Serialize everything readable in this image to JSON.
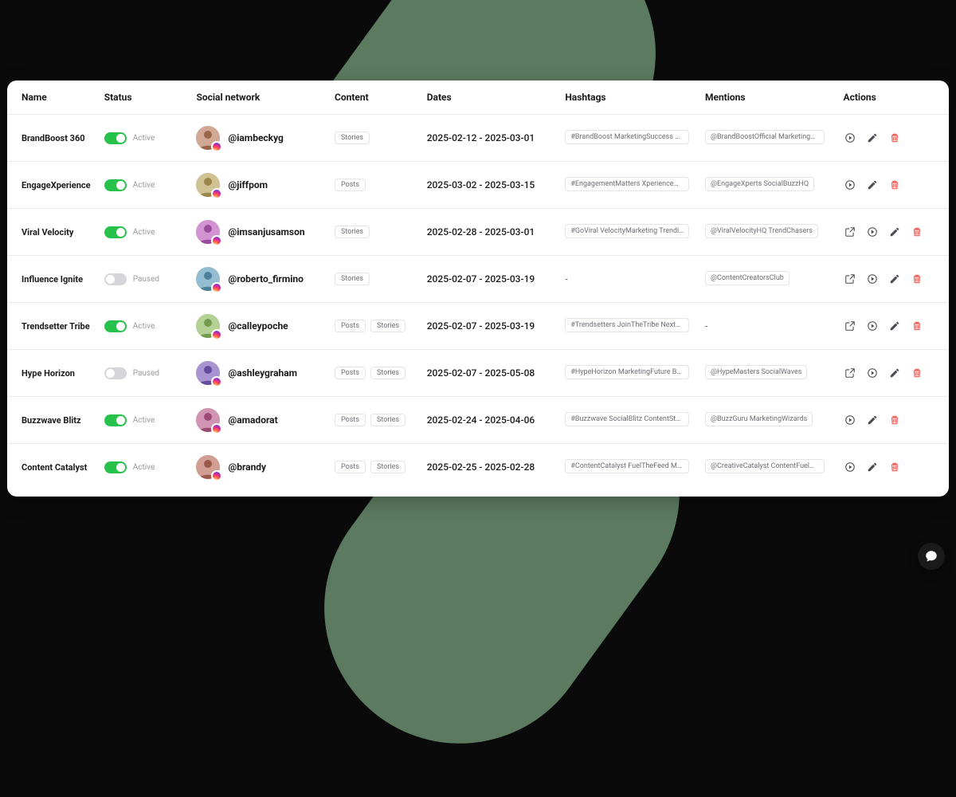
{
  "columns": {
    "name": "Name",
    "status": "Status",
    "social": "Social network",
    "content": "Content",
    "dates": "Dates",
    "hashtags": "Hashtags",
    "mentions": "Mentions",
    "actions": "Actions"
  },
  "status_labels": {
    "active": "Active",
    "paused": "Paused"
  },
  "content_chips": {
    "posts": "Posts",
    "stories": "Stories"
  },
  "rows": [
    {
      "name": "BrandBoost 360",
      "active": true,
      "handle": "@iambeckyg",
      "avatar_hue": 20,
      "content": [
        "stories"
      ],
      "dates": "2025-02-12 - 2025-03-01",
      "hashtags": "#BrandBoost MarketingSuccess BrandGrow",
      "mentions": "@BrandBoostOfficial MarketingMasters",
      "actions": [
        "play",
        "edit",
        "delete"
      ]
    },
    {
      "name": "EngageXperience",
      "active": true,
      "handle": "@jiffpom",
      "avatar_hue": 45,
      "content": [
        "posts"
      ],
      "dates": "2025-03-02 - 2025-03-15",
      "hashtags": "#EngagementMatters XperienceMarketing I",
      "mentions": "@EngageXperts SocialBuzzHQ",
      "actions": [
        "play",
        "edit",
        "delete"
      ]
    },
    {
      "name": "Viral Velocity",
      "active": true,
      "handle": "@imsanjusamson",
      "avatar_hue": 300,
      "content": [
        "stories"
      ],
      "dates": "2025-02-28 - 2025-03-01",
      "hashtags": "#GoViral VelocityMarketing TrendingNow",
      "mentions": "@ViralVelocityHQ TrendChasers",
      "actions": [
        "share",
        "play",
        "edit",
        "delete"
      ]
    },
    {
      "name": "Influence Ignite",
      "active": false,
      "handle": "@roberto_firmino",
      "avatar_hue": 200,
      "content": [
        "stories"
      ],
      "dates": "2025-02-07 - 2025-03-19",
      "hashtags": "-",
      "mentions": "@ContentCreatorsClub",
      "actions": [
        "share",
        "play",
        "edit",
        "delete"
      ]
    },
    {
      "name": "Trendsetter Tribe",
      "active": true,
      "handle": "@calleypoche",
      "avatar_hue": 90,
      "content": [
        "posts",
        "stories"
      ],
      "dates": "2025-02-07 - 2025-03-19",
      "hashtags": "#Trendsetters JoinTheTribe NextBigThing",
      "mentions": "-",
      "actions": [
        "share",
        "play",
        "edit",
        "delete"
      ]
    },
    {
      "name": "Hype Horizon",
      "active": false,
      "handle": "@ashleygraham",
      "avatar_hue": 260,
      "content": [
        "posts",
        "stories"
      ],
      "dates": "2025-02-07 - 2025-05-08",
      "hashtags": "#HypeHorizon MarketingFuture BrandBuzz",
      "mentions": "@HypeMasters SocialWaves",
      "actions": [
        "share",
        "play",
        "edit",
        "delete"
      ]
    },
    {
      "name": "Buzzwave Blitz",
      "active": true,
      "handle": "@amadorat",
      "avatar_hue": 330,
      "content": [
        "posts",
        "stories"
      ],
      "dates": "2025-02-24 - 2025-04-06",
      "hashtags": "#Buzzwave SocialBlitz ContentStorm",
      "mentions": "@BuzzGuru MarketingWizards",
      "actions": [
        "play",
        "edit",
        "delete"
      ]
    },
    {
      "name": "Content Catalyst",
      "active": true,
      "handle": "@brandy",
      "avatar_hue": 10,
      "content": [
        "posts",
        "stories"
      ],
      "dates": "2025-02-25 - 2025-02-28",
      "hashtags": "#ContentCatalyst FuelTheFeed MarketingM",
      "mentions": "@CreativeCatalyst ContentFuelHQ",
      "actions": [
        "play",
        "edit",
        "delete"
      ]
    }
  ]
}
